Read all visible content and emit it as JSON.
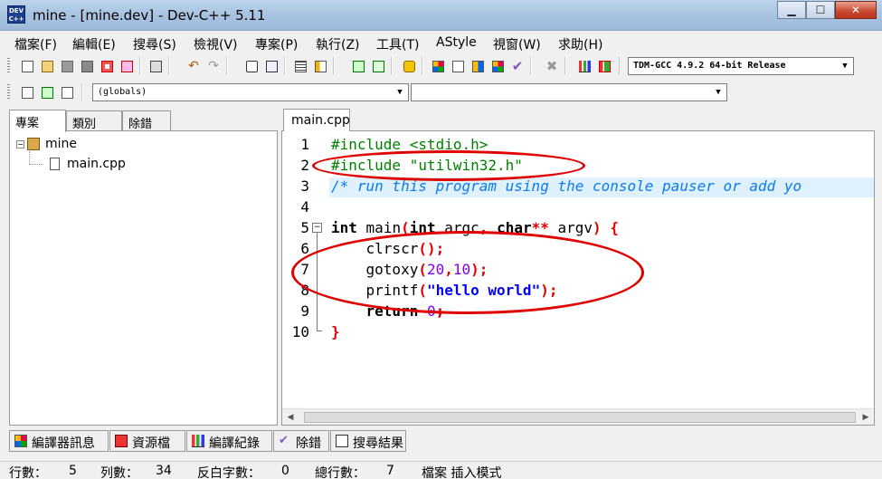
{
  "window": {
    "logo_text_top": "DEV",
    "logo_text_bottom": "C++",
    "title": "mine - [mine.dev] - Dev-C++ 5.11",
    "min_glyph": "▁",
    "max_glyph": "☐",
    "close_glyph": "✕"
  },
  "menu": [
    "檔案(F)",
    "編輯(E)",
    "搜尋(S)",
    "檢視(V)",
    "專案(P)",
    "執行(Z)",
    "工具(T)",
    "AStyle",
    "視窗(W)",
    "求助(H)"
  ],
  "toolbar": {
    "compiler_select": "TDM-GCC 4.9.2 64-bit Release",
    "scope_select": "(globals)",
    "member_select": ""
  },
  "left_panel": {
    "tabs": [
      "專案",
      "類別",
      "除錯"
    ],
    "active_tab": "專案",
    "tree": {
      "project_name": "mine",
      "expander_glyph": "⊟",
      "files": [
        "main.cpp"
      ]
    }
  },
  "editor": {
    "tab_label": "main.cpp",
    "line_numbers": [
      "1",
      "2",
      "3",
      "4",
      "5",
      "6",
      "7",
      "8",
      "9",
      "10"
    ],
    "lines": {
      "l1": "#include <stdio.h>",
      "l2": "#include \"utilwin32.h\"",
      "l3": "/* run this program using the console pauser or add yo",
      "l5_kw1": "int",
      "l5_rest1": " main",
      "l5_p1": "(",
      "l5_kw2": "int",
      "l5_rest2": " argc",
      "l5_comma": ",",
      "l5_kw3": " char",
      "l5_stars": "**",
      "l5_rest3": " argv",
      "l5_p2": ")",
      "l5_brace": " {",
      "l6_fn": "    clrscr",
      "l6_sym": "();",
      "l7_fn": "    gotoxy",
      "l7_p1": "(",
      "l7_n1": "20",
      "l7_comma": ",",
      "l7_n2": "10",
      "l7_sym": ");",
      "l8_fn": "    printf",
      "l8_p1": "(",
      "l8_str": "\"hello world\"",
      "l8_sym": ");",
      "l9_kw": "    return",
      "l9_num": " 0",
      "l9_sym": ";",
      "l10": "}"
    },
    "fold_glyph": "−"
  },
  "bottom_tabs": [
    "編譯器訊息",
    "資源檔",
    "編譯紀錄",
    "除錯",
    "搜尋結果"
  ],
  "status": {
    "line_label": "行數：",
    "line": "5",
    "col_label": "列數：",
    "col": "34",
    "sel_label": "反白字數：",
    "sel": "0",
    "total_label": "總行數：",
    "total": "7",
    "mode": "檔案 插入模式"
  },
  "colors": {
    "annotation": "#e00000",
    "preprocessor": "#008000",
    "comment": "#0a7cf0",
    "string": "#0000ff",
    "number": "#8000ff",
    "symbol": "#e00000"
  }
}
